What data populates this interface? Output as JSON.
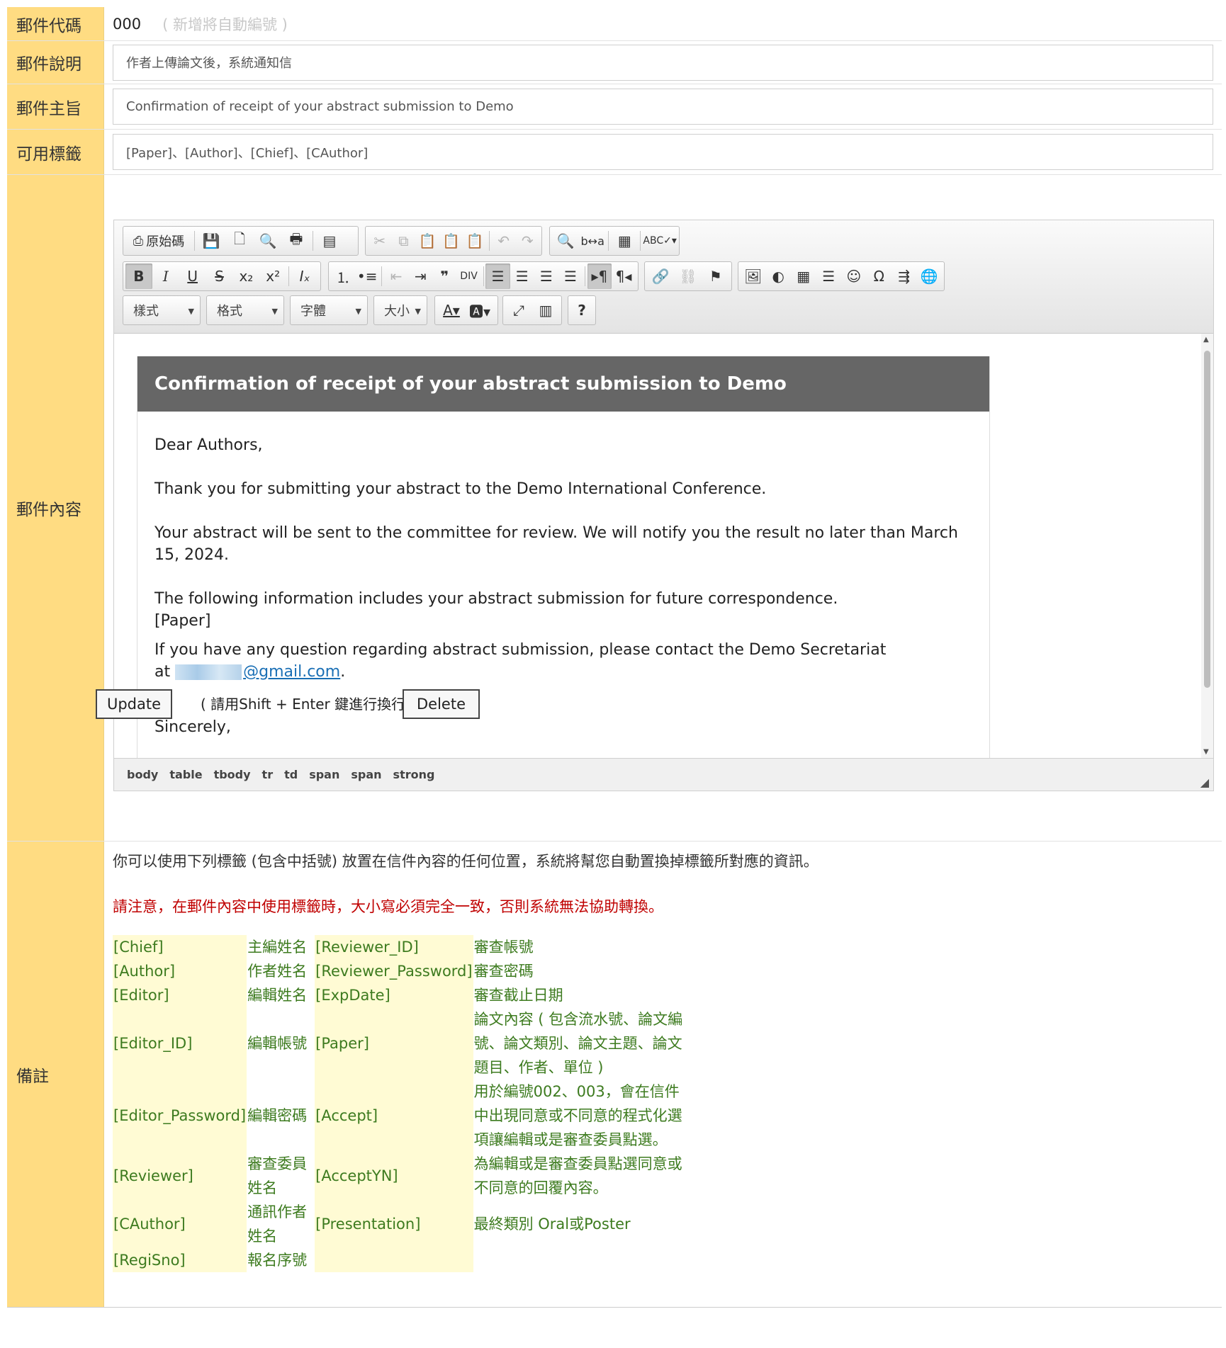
{
  "rows": {
    "code": {
      "label": "郵件代碼",
      "value": "000",
      "hint": "( 新增將自動編號 )"
    },
    "desc": {
      "label": "郵件說明",
      "value": "作者上傳論文後，系統通知信"
    },
    "subject": {
      "label": "郵件主旨",
      "value": "Confirmation of receipt of your abstract submission to Demo"
    },
    "tags": {
      "label": "可用標籤",
      "value": "[Paper]、[Author]、[Chief]、[CAuthor]"
    },
    "content": {
      "label": "郵件內容"
    },
    "notes": {
      "label": "備註"
    }
  },
  "editor": {
    "source_label": "原始碼",
    "combos": {
      "style": "樣式",
      "format": "格式",
      "font": "字體",
      "size": "大小"
    },
    "help": "?",
    "mail_title": "Confirmation of receipt of your abstract submission to Demo",
    "greeting": "Dear Authors,",
    "p1": "Thank you for submitting your abstract to the Demo International Conference.",
    "p2": "Your abstract will be sent to the committee for review. We will notify you the result no later than March 15, 2024.",
    "p3a": "The following information includes your abstract submission for future correspondence.",
    "p3b": "[Paper]",
    "p4a": "If you have any question regarding abstract submission, please contact the Demo Secretariat",
    "p4at": "at ",
    "email_visible": "@gmail.com",
    "p4end": ".",
    "closing_partial": "Sincerely,",
    "path": [
      "body",
      "table",
      "tbody",
      "tr",
      "td",
      "span",
      "span",
      "strong"
    ]
  },
  "actions": {
    "update": "Update",
    "hint": "( 請用Shift + Enter 鍵進行換行 )",
    "delete": "Delete"
  },
  "notes": {
    "intro": "你可以使用下列標籤 (包含中括號) 放置在信件內容的任何位置，系統將幫您自動置換掉標籤所對應的資訊。",
    "warning": "請注意，在郵件內容中使用標籤時，大小寫必須完全一致，否則系統無法協助轉換。",
    "table": [
      [
        "[Chief]",
        "主編姓名",
        "[Reviewer_ID]",
        "審查帳號"
      ],
      [
        "[Author]",
        "作者姓名",
        "[Reviewer_Password]",
        "審查密碼"
      ],
      [
        "[Editor]",
        "編輯姓名",
        "[ExpDate]",
        "審查截止日期"
      ],
      [
        "[Editor_ID]",
        "編輯帳號",
        "[Paper]",
        "論文內容 ( 包含流水號、論文編號、論文類別、論文主題、論文題目、作者、單位 )"
      ],
      [
        "[Editor_Password]",
        "編輯密碼",
        "[Accept]",
        "用於編號002、003，會在信件中出現同意或不同意的程式化選項讓編輯或是審查委員點選。"
      ],
      [
        "[Reviewer]",
        "審查委員姓名",
        "[AcceptYN]",
        "為編輯或是審查委員點選同意或不同意的回覆內容。"
      ],
      [
        "[CAuthor]",
        "通訊作者姓名",
        "[Presentation]",
        "最終類別 Oral或Poster"
      ],
      [
        "[RegiSno]",
        "報名序號",
        "",
        ""
      ]
    ]
  },
  "colors": {
    "label_bg": "#ffdc82",
    "tag_bg": "#fffbd4",
    "tag_text": "#3d7b1f",
    "warning": "#c00000",
    "mail_header": "#666666"
  }
}
